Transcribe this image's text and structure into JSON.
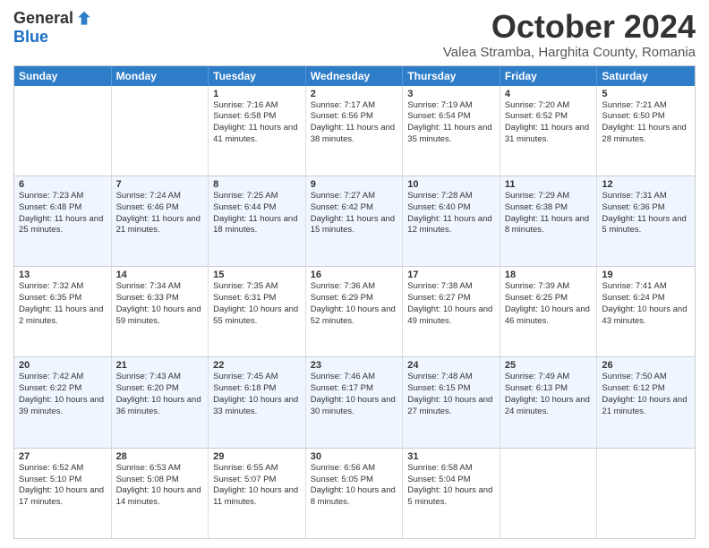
{
  "logo": {
    "general": "General",
    "blue": "Blue"
  },
  "title": "October 2024",
  "location": "Valea Stramba, Harghita County, Romania",
  "days": [
    "Sunday",
    "Monday",
    "Tuesday",
    "Wednesday",
    "Thursday",
    "Friday",
    "Saturday"
  ],
  "weeks": [
    [
      {
        "day": "",
        "sunrise": "",
        "sunset": "",
        "daylight": ""
      },
      {
        "day": "",
        "sunrise": "",
        "sunset": "",
        "daylight": ""
      },
      {
        "day": "1",
        "sunrise": "Sunrise: 7:16 AM",
        "sunset": "Sunset: 6:58 PM",
        "daylight": "Daylight: 11 hours and 41 minutes."
      },
      {
        "day": "2",
        "sunrise": "Sunrise: 7:17 AM",
        "sunset": "Sunset: 6:56 PM",
        "daylight": "Daylight: 11 hours and 38 minutes."
      },
      {
        "day": "3",
        "sunrise": "Sunrise: 7:19 AM",
        "sunset": "Sunset: 6:54 PM",
        "daylight": "Daylight: 11 hours and 35 minutes."
      },
      {
        "day": "4",
        "sunrise": "Sunrise: 7:20 AM",
        "sunset": "Sunset: 6:52 PM",
        "daylight": "Daylight: 11 hours and 31 minutes."
      },
      {
        "day": "5",
        "sunrise": "Sunrise: 7:21 AM",
        "sunset": "Sunset: 6:50 PM",
        "daylight": "Daylight: 11 hours and 28 minutes."
      }
    ],
    [
      {
        "day": "6",
        "sunrise": "Sunrise: 7:23 AM",
        "sunset": "Sunset: 6:48 PM",
        "daylight": "Daylight: 11 hours and 25 minutes."
      },
      {
        "day": "7",
        "sunrise": "Sunrise: 7:24 AM",
        "sunset": "Sunset: 6:46 PM",
        "daylight": "Daylight: 11 hours and 21 minutes."
      },
      {
        "day": "8",
        "sunrise": "Sunrise: 7:25 AM",
        "sunset": "Sunset: 6:44 PM",
        "daylight": "Daylight: 11 hours and 18 minutes."
      },
      {
        "day": "9",
        "sunrise": "Sunrise: 7:27 AM",
        "sunset": "Sunset: 6:42 PM",
        "daylight": "Daylight: 11 hours and 15 minutes."
      },
      {
        "day": "10",
        "sunrise": "Sunrise: 7:28 AM",
        "sunset": "Sunset: 6:40 PM",
        "daylight": "Daylight: 11 hours and 12 minutes."
      },
      {
        "day": "11",
        "sunrise": "Sunrise: 7:29 AM",
        "sunset": "Sunset: 6:38 PM",
        "daylight": "Daylight: 11 hours and 8 minutes."
      },
      {
        "day": "12",
        "sunrise": "Sunrise: 7:31 AM",
        "sunset": "Sunset: 6:36 PM",
        "daylight": "Daylight: 11 hours and 5 minutes."
      }
    ],
    [
      {
        "day": "13",
        "sunrise": "Sunrise: 7:32 AM",
        "sunset": "Sunset: 6:35 PM",
        "daylight": "Daylight: 11 hours and 2 minutes."
      },
      {
        "day": "14",
        "sunrise": "Sunrise: 7:34 AM",
        "sunset": "Sunset: 6:33 PM",
        "daylight": "Daylight: 10 hours and 59 minutes."
      },
      {
        "day": "15",
        "sunrise": "Sunrise: 7:35 AM",
        "sunset": "Sunset: 6:31 PM",
        "daylight": "Daylight: 10 hours and 55 minutes."
      },
      {
        "day": "16",
        "sunrise": "Sunrise: 7:36 AM",
        "sunset": "Sunset: 6:29 PM",
        "daylight": "Daylight: 10 hours and 52 minutes."
      },
      {
        "day": "17",
        "sunrise": "Sunrise: 7:38 AM",
        "sunset": "Sunset: 6:27 PM",
        "daylight": "Daylight: 10 hours and 49 minutes."
      },
      {
        "day": "18",
        "sunrise": "Sunrise: 7:39 AM",
        "sunset": "Sunset: 6:25 PM",
        "daylight": "Daylight: 10 hours and 46 minutes."
      },
      {
        "day": "19",
        "sunrise": "Sunrise: 7:41 AM",
        "sunset": "Sunset: 6:24 PM",
        "daylight": "Daylight: 10 hours and 43 minutes."
      }
    ],
    [
      {
        "day": "20",
        "sunrise": "Sunrise: 7:42 AM",
        "sunset": "Sunset: 6:22 PM",
        "daylight": "Daylight: 10 hours and 39 minutes."
      },
      {
        "day": "21",
        "sunrise": "Sunrise: 7:43 AM",
        "sunset": "Sunset: 6:20 PM",
        "daylight": "Daylight: 10 hours and 36 minutes."
      },
      {
        "day": "22",
        "sunrise": "Sunrise: 7:45 AM",
        "sunset": "Sunset: 6:18 PM",
        "daylight": "Daylight: 10 hours and 33 minutes."
      },
      {
        "day": "23",
        "sunrise": "Sunrise: 7:46 AM",
        "sunset": "Sunset: 6:17 PM",
        "daylight": "Daylight: 10 hours and 30 minutes."
      },
      {
        "day": "24",
        "sunrise": "Sunrise: 7:48 AM",
        "sunset": "Sunset: 6:15 PM",
        "daylight": "Daylight: 10 hours and 27 minutes."
      },
      {
        "day": "25",
        "sunrise": "Sunrise: 7:49 AM",
        "sunset": "Sunset: 6:13 PM",
        "daylight": "Daylight: 10 hours and 24 minutes."
      },
      {
        "day": "26",
        "sunrise": "Sunrise: 7:50 AM",
        "sunset": "Sunset: 6:12 PM",
        "daylight": "Daylight: 10 hours and 21 minutes."
      }
    ],
    [
      {
        "day": "27",
        "sunrise": "Sunrise: 6:52 AM",
        "sunset": "Sunset: 5:10 PM",
        "daylight": "Daylight: 10 hours and 17 minutes."
      },
      {
        "day": "28",
        "sunrise": "Sunrise: 6:53 AM",
        "sunset": "Sunset: 5:08 PM",
        "daylight": "Daylight: 10 hours and 14 minutes."
      },
      {
        "day": "29",
        "sunrise": "Sunrise: 6:55 AM",
        "sunset": "Sunset: 5:07 PM",
        "daylight": "Daylight: 10 hours and 11 minutes."
      },
      {
        "day": "30",
        "sunrise": "Sunrise: 6:56 AM",
        "sunset": "Sunset: 5:05 PM",
        "daylight": "Daylight: 10 hours and 8 minutes."
      },
      {
        "day": "31",
        "sunrise": "Sunrise: 6:58 AM",
        "sunset": "Sunset: 5:04 PM",
        "daylight": "Daylight: 10 hours and 5 minutes."
      },
      {
        "day": "",
        "sunrise": "",
        "sunset": "",
        "daylight": ""
      },
      {
        "day": "",
        "sunrise": "",
        "sunset": "",
        "daylight": ""
      }
    ]
  ]
}
